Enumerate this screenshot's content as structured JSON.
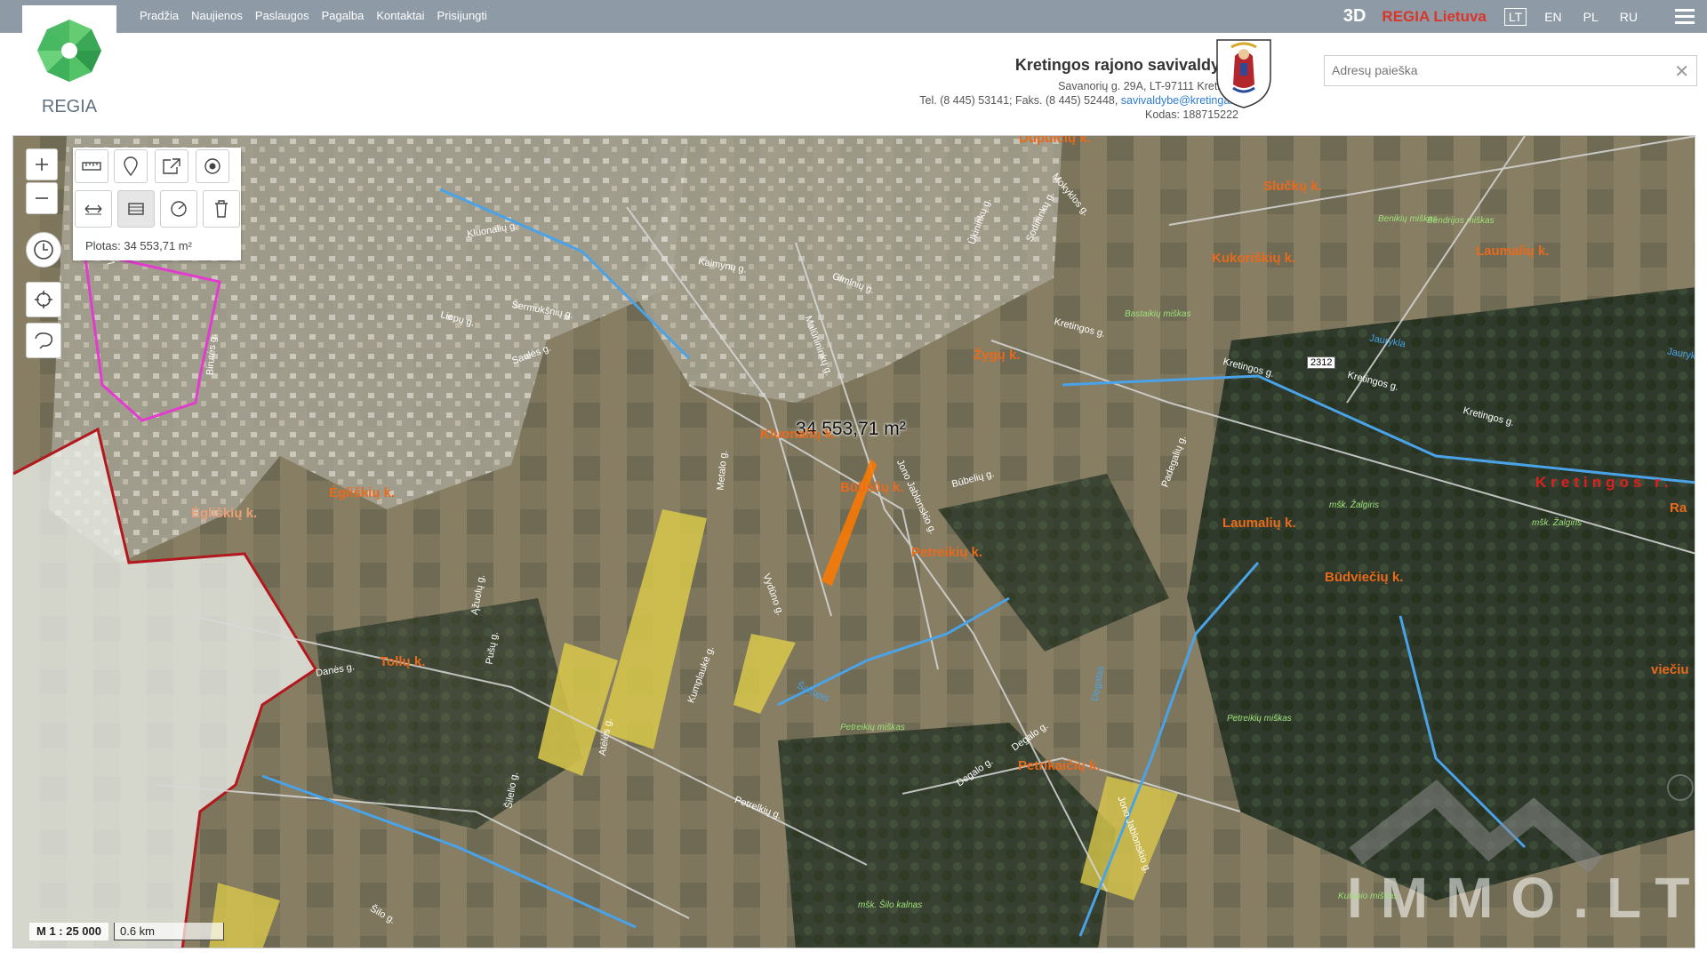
{
  "nav": {
    "items": [
      "Pradžia",
      "Naujienos",
      "Paslaugos",
      "Pagalba",
      "Kontaktai",
      "Prisijungti"
    ],
    "btn_3d": "3D",
    "regia_lietuva": "REGIA Lietuva",
    "languages": [
      "LT",
      "EN",
      "PL",
      "RU"
    ],
    "active_language": "LT"
  },
  "logo": {
    "text": "REGIA"
  },
  "municipality": {
    "name": "Kretingos rajono savivaldybė",
    "address": "Savanorių g. 29A, LT-97111 Kretinga",
    "phone_prefix": "Tel. (8 445) 53141; Faks. (8 445) 52448, ",
    "email": "savivaldybe@kretinga.lt",
    "code": "Kodas: 188715222"
  },
  "search": {
    "placeholder": "Adresų paieška",
    "value": ""
  },
  "tools": {
    "measure_result": "Plotas: 34 553,71 m²"
  },
  "map": {
    "area_label": "34 553,71 m²",
    "scale_ratio": "M 1 : 25 000",
    "scale_bar": "0.6 km",
    "road_badge": "2312",
    "watermark": "IMMO.LT",
    "district_label": "Kretingos r.",
    "villages": [
      "Dupulčių k.",
      "Slučkų k.",
      "Kukoriškių k.",
      "Laumalių k.",
      "Žygų k.",
      "Kluonalių k.",
      "Būbelių k.",
      "Ėgliškių k.",
      "Ėgliškių k.",
      "Laumalių k.",
      "Petreikių k.",
      "Būdviečių k.",
      "Tollų k.",
      "Petrikaičių k.",
      "Ra",
      "viečiu"
    ],
    "forests": [
      "Benikių miškas",
      "Bastaikių miškas",
      "Bendrijos miškas",
      "mšk. Žalgiris",
      "mšk. Žalgiris",
      "Petreikių miškas",
      "Petreikių miškas",
      "mšk. Šilo kalnas",
      "Kulupio miškas"
    ],
    "streets": [
      "Kretingos g.",
      "Kretingos g.",
      "Kretingos g.",
      "Kretingos g.",
      "Jaurykla",
      "Jaurykla",
      "Šaltupis",
      "Degalas",
      "Degalo g.",
      "Degalo g.",
      "Petrelkių g.",
      "Jono Jablonskio g.",
      "Jono Jablonskio g.",
      "Malūnininkų g.",
      "Metalo g.",
      "Vydūno g.",
      "Kumplaukė g.",
      "Atėlės g.",
      "Pušų g.",
      "Ąžuolų g.",
      "Danės g.",
      "Šilo g.",
      "Šilelio g.",
      "Gimlnių g.",
      "Kaimynų g.",
      "Kluonalių g.",
      "Vytauto g.",
      "Birutės g.",
      "Būbelių g.",
      "Padegalių g.",
      "Mokyklos g.",
      "Sodininkų g.",
      "Ūkininkų g.",
      "Šermukšnių g.",
      "Liepų g.",
      "Saulės g."
    ],
    "colors": {
      "area": "#ff7a00",
      "boundary": "#b3181e",
      "river": "#4aa3e8",
      "highlight": "#e33bd0"
    }
  }
}
